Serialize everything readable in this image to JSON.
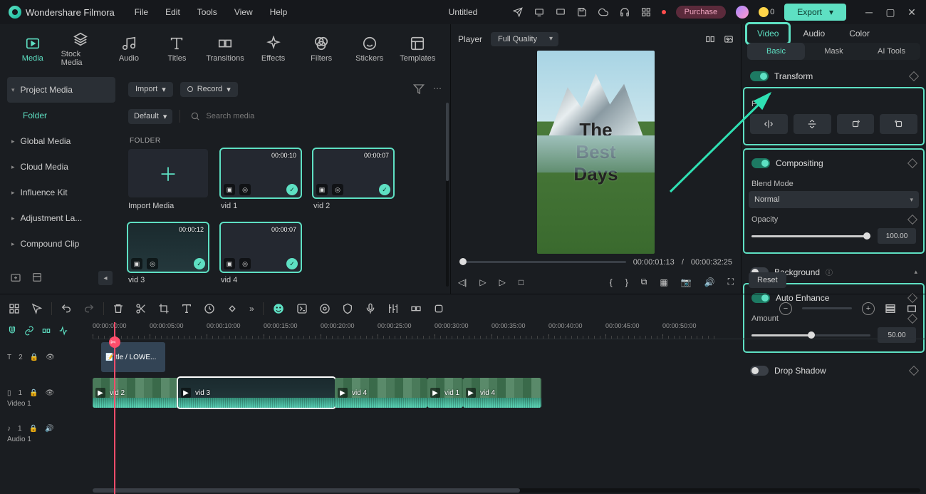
{
  "app": {
    "name": "Wondershare Filmora",
    "title": "Untitled",
    "purchase": "Purchase",
    "coins": "0",
    "export": "Export"
  },
  "menu": {
    "file": "File",
    "edit": "Edit",
    "tools": "Tools",
    "view": "View",
    "help": "Help"
  },
  "tabs": {
    "media": "Media",
    "stock": "Stock Media",
    "audio": "Audio",
    "titles": "Titles",
    "transitions": "Transitions",
    "effects": "Effects",
    "filters": "Filters",
    "stickers": "Stickers",
    "templates": "Templates"
  },
  "sidebar": {
    "project": "Project Media",
    "folder": "Folder",
    "global": "Global Media",
    "cloud": "Cloud Media",
    "influence": "Influence Kit",
    "adjust": "Adjustment La...",
    "compound": "Compound Clip"
  },
  "browser": {
    "import": "Import",
    "record": "Record",
    "default": "Default",
    "search_ph": "Search media",
    "folder": "FOLDER",
    "import_media": "Import Media",
    "clips": [
      {
        "name": "vid 1",
        "dur": "00:00:10"
      },
      {
        "name": "vid 2",
        "dur": "00:00:07"
      },
      {
        "name": "vid 3",
        "dur": "00:00:12"
      },
      {
        "name": "vid 4",
        "dur": "00:00:07"
      }
    ]
  },
  "player": {
    "label": "Player",
    "quality": "Full Quality",
    "line1": "The",
    "line2": "Best",
    "line3": "Days",
    "current": "00:00:01:13",
    "sep": "/",
    "total": "00:00:32:25"
  },
  "inspector": {
    "tabs": {
      "video": "Video",
      "audio": "Audio",
      "color": "Color"
    },
    "subtabs": {
      "basic": "Basic",
      "mask": "Mask",
      "ai": "AI Tools"
    },
    "transform": "Transform",
    "flip": "Flip",
    "compositing": "Compositing",
    "blend": "Blend Mode",
    "normal": "Normal",
    "opacity": "Opacity",
    "opacity_v": "100.00",
    "background": "Background",
    "autoenhance": "Auto Enhance",
    "amount": "Amount",
    "amount_v": "50.00",
    "dropshadow": "Drop Shadow",
    "reset": "Reset"
  },
  "timeline": {
    "ruler": [
      "00:00:00:00",
      "00:00:05:00",
      "00:00:10:00",
      "00:00:15:00",
      "00:00:20:00",
      "00:00:25:00",
      "00:00:30:00",
      "00:00:35:00",
      "00:00:40:00",
      "00:00:45:00",
      "00:00:50:00"
    ],
    "track_text_lbl": "",
    "track_video": "Video 1",
    "track_audio": "Audio 1",
    "text_clip": "itle / LOWE...",
    "v": [
      {
        "n": "vid 2"
      },
      {
        "n": "vid 3"
      },
      {
        "n": "vid 4"
      },
      {
        "n": "vid 1"
      },
      {
        "n": "vid 4"
      }
    ]
  }
}
